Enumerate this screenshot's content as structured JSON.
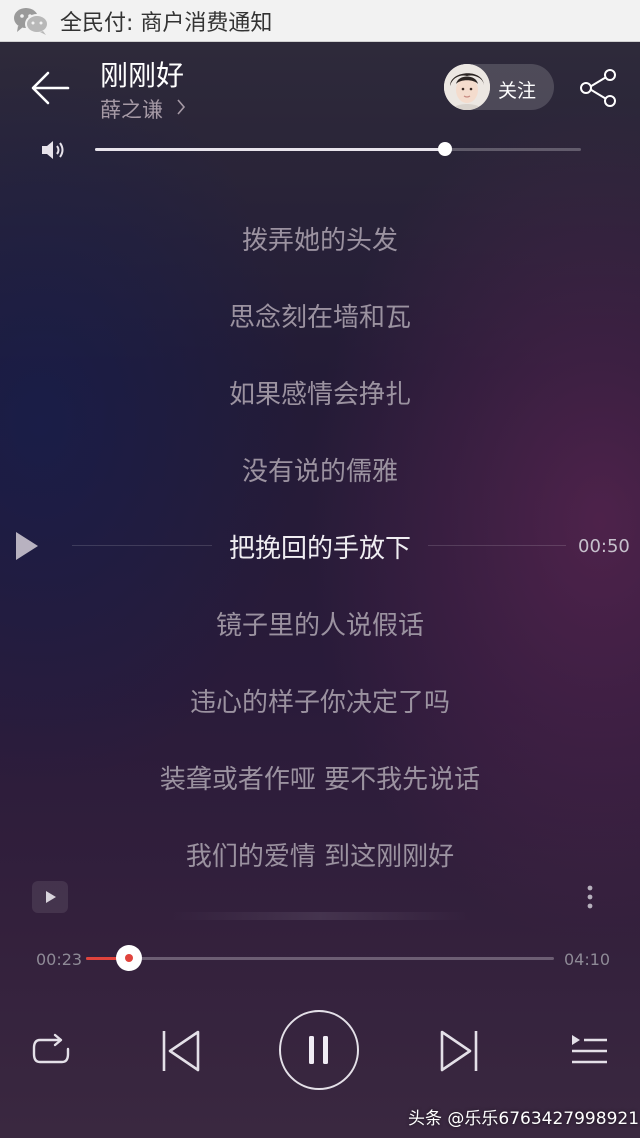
{
  "status_bar": {
    "notification_text": "全民付: 商户消费通知",
    "app_icon": "wechat-icon"
  },
  "header": {
    "back_icon": "back-arrow-icon",
    "song_title": "刚刚好",
    "artist": "薛之谦",
    "artist_chevron": ">",
    "follow_label": "关注",
    "share_icon": "share-icon"
  },
  "volume": {
    "icon": "speaker-icon",
    "level": 0.72
  },
  "lyrics": {
    "lines": [
      "拨弄她的头发",
      "思念刻在墙和瓦",
      "如果感情会挣扎",
      "没有说的儒雅",
      "把挽回的手放下",
      "镜子里的人说假话",
      "违心的样子你决定了吗",
      "装聋或者作哑 要不我先说话",
      "我们的爱情 到这刚刚好"
    ],
    "current_index": 4,
    "seek_time": "00:50"
  },
  "progress": {
    "elapsed": "00:23",
    "duration": "04:10",
    "fraction": 0.092
  },
  "controls": {
    "repeat_icon": "repeat-icon",
    "previous_icon": "previous-track-icon",
    "pause_icon": "pause-icon",
    "next_icon": "next-track-icon",
    "playlist_icon": "playlist-icon"
  },
  "watermark": "头条 @乐乐6763427998921",
  "colors": {
    "progress_played": "#e0433c",
    "accent_white": "#ffffff"
  }
}
